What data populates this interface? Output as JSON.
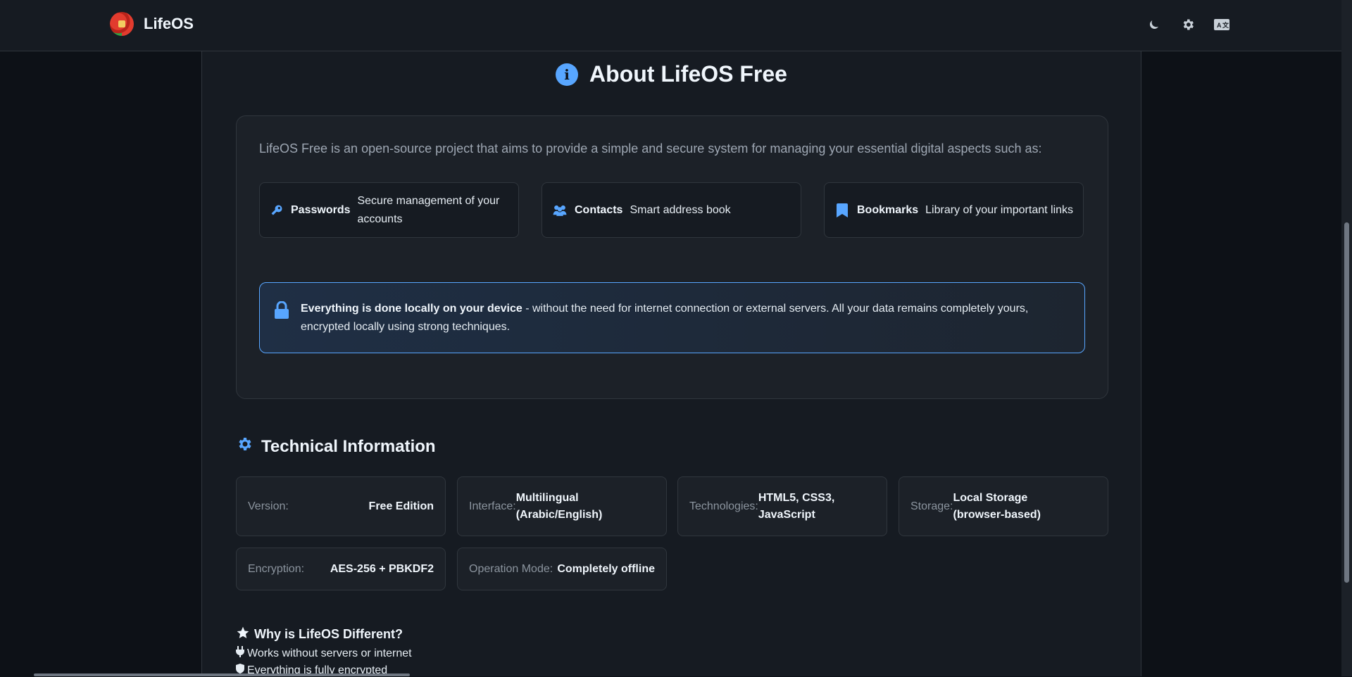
{
  "header": {
    "brand": "LifeOS",
    "icons": [
      "moon-icon",
      "gear-icon",
      "language-icon"
    ]
  },
  "about": {
    "title": "About LifeOS Free",
    "intro": "LifeOS Free is an open-source project that aims to provide a simple and secure system for managing your essential digital aspects such as:",
    "features": [
      {
        "name": "Passwords",
        "desc": "Secure management of your accounts",
        "icon": "key-icon"
      },
      {
        "name": "Contacts",
        "desc": "Smart address book",
        "icon": "users-icon"
      },
      {
        "name": "Bookmarks",
        "desc": "Library of your important links",
        "icon": "bookmark-icon"
      }
    ],
    "notice_bold": "Everything is done locally on your device",
    "notice_text": " - without the need for internet connection or external servers. All your data remains completely yours, encrypted locally using strong techniques."
  },
  "tech": {
    "title": "Technical Information",
    "items": [
      {
        "label": "Version:",
        "value": "Free Edition"
      },
      {
        "label": "Interface:",
        "value": "Multilingual (Arabic/English)"
      },
      {
        "label": "Technologies:",
        "value": "HTML5, CSS3, JavaScript"
      },
      {
        "label": "Storage:",
        "value": "Local Storage (browser-based)"
      },
      {
        "label": "Encryption:",
        "value": "AES-256 + PBKDF2"
      },
      {
        "label": "Operation Mode:",
        "value": "Completely offline"
      }
    ]
  },
  "why": {
    "title": "Why is LifeOS Different?",
    "items": [
      "Works without servers or internet",
      "Everything is fully encrypted"
    ]
  },
  "colors": {
    "accent": "#58a6ff",
    "background": "#0d1117",
    "surface": "#161b22"
  }
}
